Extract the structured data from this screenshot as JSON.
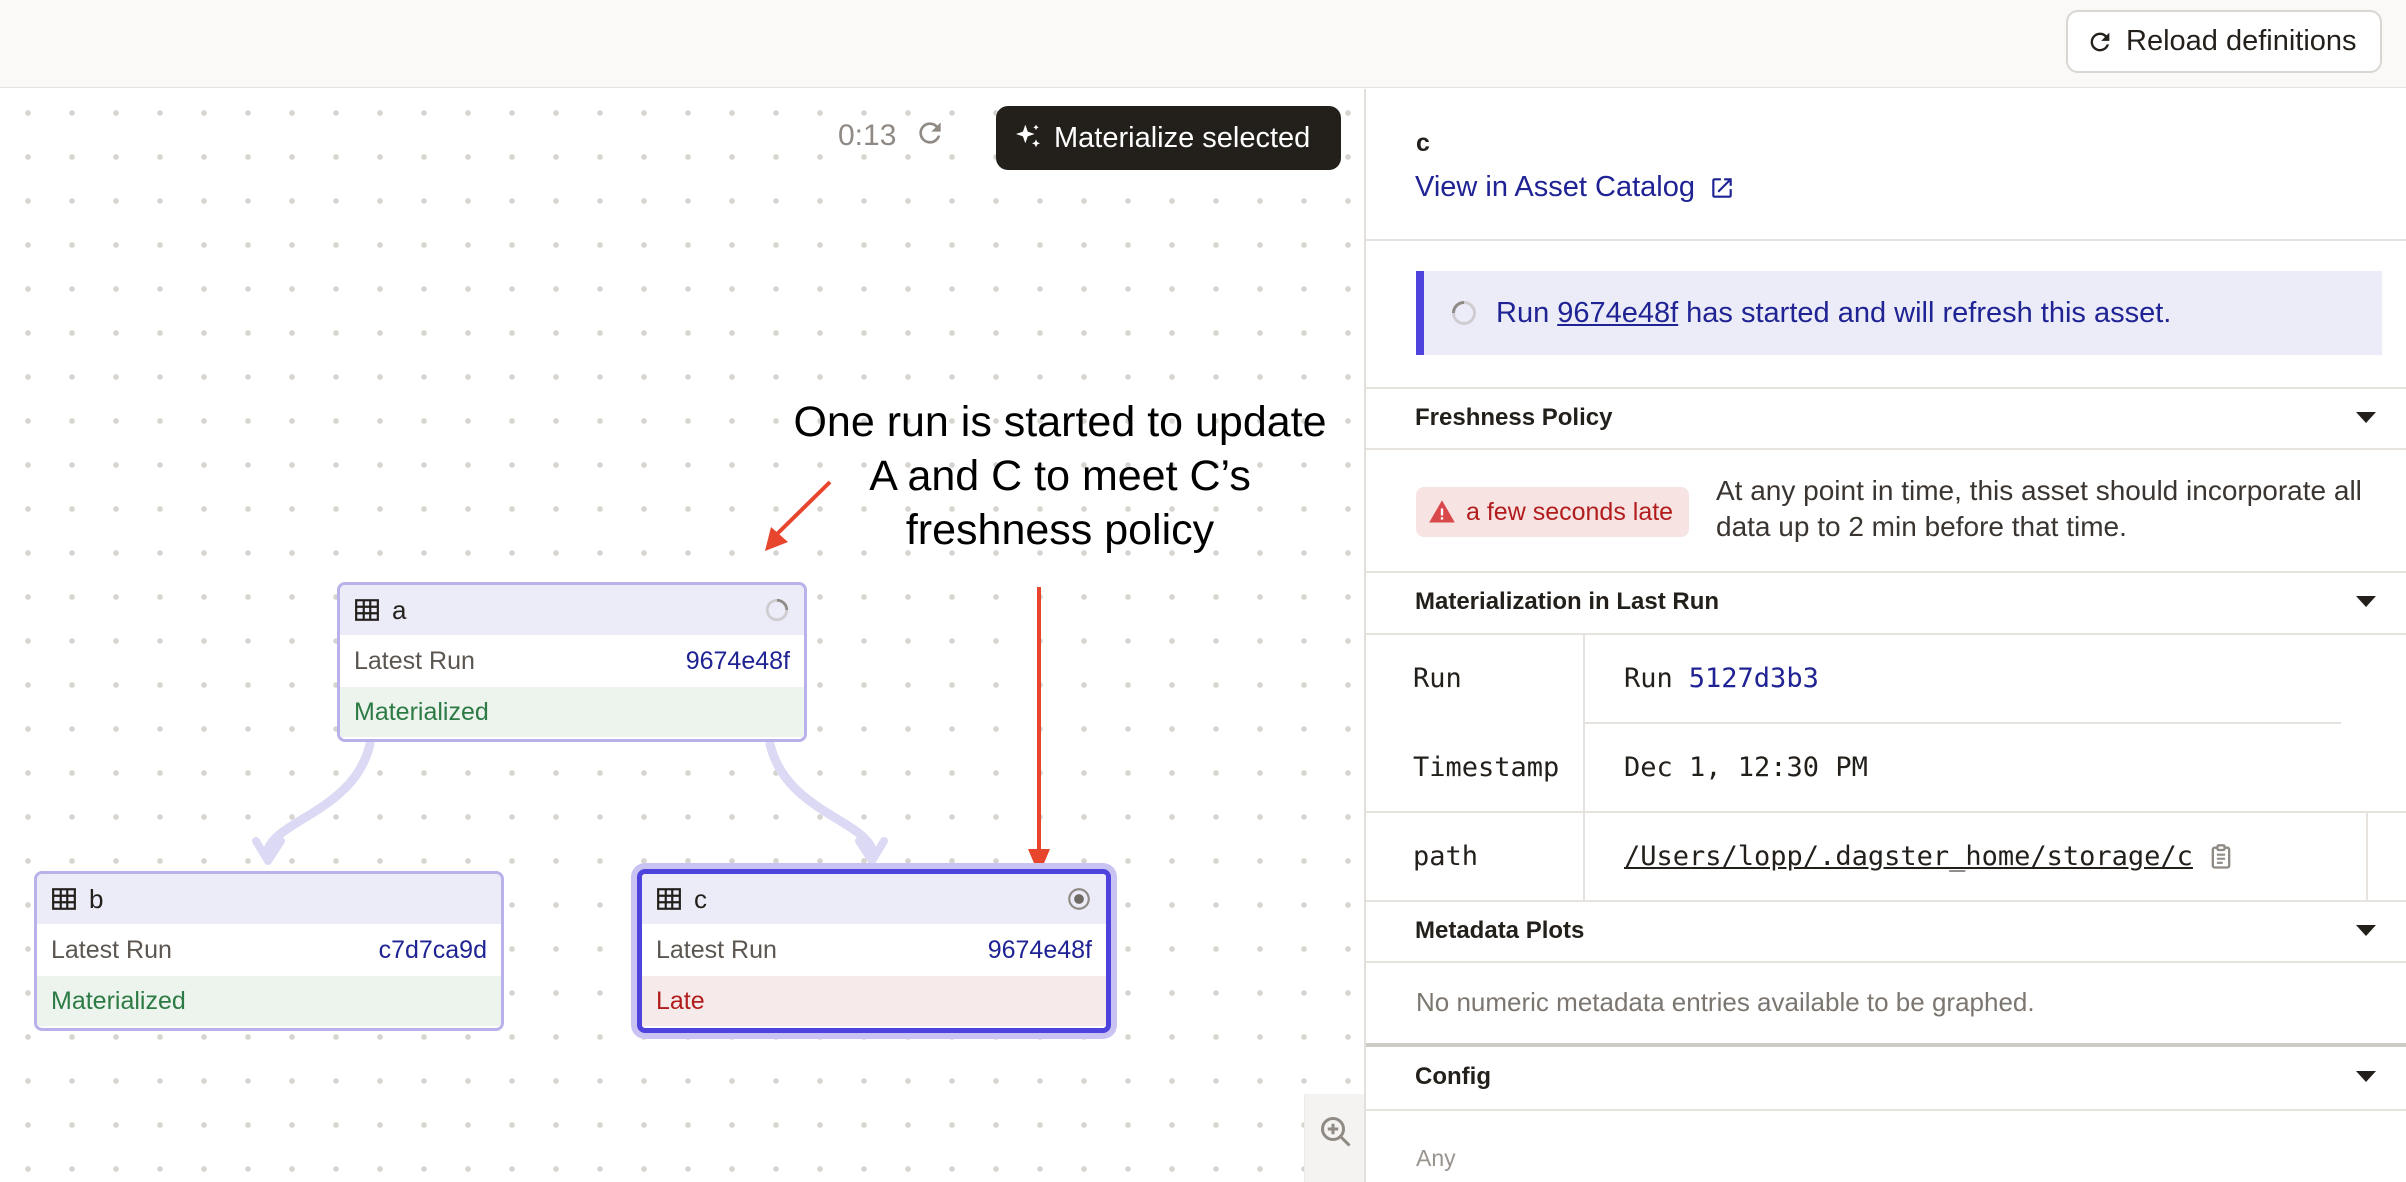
{
  "header": {
    "reload_label": "Reload definitions",
    "reload_icon": "refresh-icon"
  },
  "graph": {
    "timer": "0:13",
    "materialize_label": "Materialize selected",
    "annotation": "One run is started to update A and C to meet C’s freshness policy",
    "annotation_lines": [
      "One run is started to update",
      "A and C to meet C’s",
      "freshness policy"
    ],
    "nodes": [
      {
        "name": "a",
        "run_label": "Latest Run",
        "run_id": "9674e48f",
        "status": "Materialized",
        "status_kind": "ok",
        "icon": "spinner-icon"
      },
      {
        "name": "b",
        "run_label": "Latest Run",
        "run_id": "c7d7ca9d",
        "status": "Materialized",
        "status_kind": "ok",
        "icon": ""
      },
      {
        "name": "c",
        "run_label": "Latest Run",
        "run_id": "9674e48f",
        "status": "Late",
        "status_kind": "late",
        "icon": "radio-selected-icon"
      }
    ],
    "colors": {
      "arrow": "#e8452d",
      "node_border": "#b8b1ea",
      "node_selected": "#4f43dd",
      "materialized": "#2c7a44",
      "late": "#b11d1d"
    }
  },
  "panel": {
    "asset_name": "c",
    "catalog_link": "View in Asset Catalog",
    "banner": {
      "prefix": "Run",
      "run_id": "9674e48f",
      "suffix": "has started and will refresh this asset."
    },
    "freshness": {
      "title": "Freshness Policy",
      "badge": "a few seconds late",
      "description": "At any point in time, this asset should incorporate all data up to 2 min before that time."
    },
    "materialization": {
      "title": "Materialization in Last Run",
      "rows": [
        {
          "key": "Run",
          "value_prefix": "Run",
          "value": "5127d3b3"
        },
        {
          "key": "Timestamp",
          "value": "Dec 1, 12:30 PM"
        },
        {
          "key": "path",
          "value": "/Users/lopp/.dagster_home/storage/c"
        }
      ]
    },
    "metadata_plots": {
      "title": "Metadata Plots",
      "empty": "No numeric metadata entries available to be graphed."
    },
    "config": {
      "title": "Config",
      "value": "Any"
    }
  }
}
